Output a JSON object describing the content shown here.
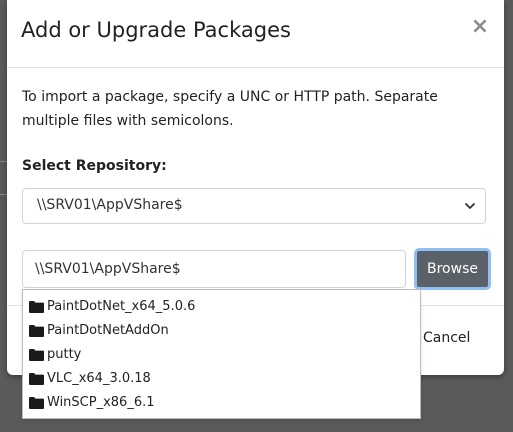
{
  "modal": {
    "title": "Add or Upgrade Packages",
    "close_label": "×",
    "help_text": "To import a package, specify a UNC or HTTP path. Separate multiple files with semicolons.",
    "repository_label": "Select Repository:",
    "repository_selected": "\\\\SRV01\\AppVShare$",
    "path_value": "\\\\SRV01\\AppVShare$",
    "browse_label": "Browse",
    "cancel_label": "Cancel"
  },
  "suggestions": [
    {
      "label": "PaintDotNet_x64_5.0.6",
      "icon": "folder-icon"
    },
    {
      "label": "PaintDotNetAddOn",
      "icon": "folder-icon"
    },
    {
      "label": "putty",
      "icon": "folder-icon"
    },
    {
      "label": "VLC_x64_3.0.18",
      "icon": "folder-icon"
    },
    {
      "label": "WinSCP_x86_6.1",
      "icon": "folder-icon"
    }
  ],
  "colors": {
    "browse_bg": "#5b6168",
    "focus_ring": "#8fbff3",
    "overlay": "#4b4b4b"
  }
}
